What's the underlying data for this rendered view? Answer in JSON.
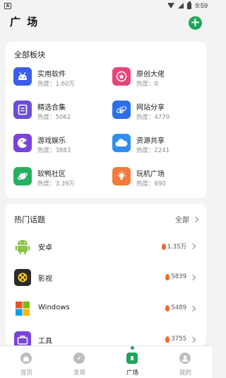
{
  "status": {
    "time": "9:59",
    "left_badge": "A"
  },
  "header": {
    "title": "广 场",
    "add_label": "+"
  },
  "boards": {
    "heading": "全部板块",
    "items": [
      {
        "name": "实用软件",
        "heat": "热度：1.60万",
        "icon": "android-icon",
        "color": "#3c5de8"
      },
      {
        "name": "原创大佬",
        "heat": "热度：0",
        "icon": "star-badge-icon",
        "color": "#e6447a"
      },
      {
        "name": "精选合集",
        "heat": "热度：5062",
        "icon": "collection-icon",
        "color": "#6b4ed6"
      },
      {
        "name": "网站分享",
        "heat": "热度：4770",
        "icon": "browser-icon",
        "color": "#2f6ee8"
      },
      {
        "name": "游戏娱乐",
        "heat": "热度：3883",
        "icon": "pacman-icon",
        "color": "#7a44d8"
      },
      {
        "name": "资源共享",
        "heat": "热度：2241",
        "icon": "cloud-icon",
        "color": "#2f8ff0"
      },
      {
        "name": "软鸭社区",
        "heat": "热度：3.39万",
        "icon": "planet-icon",
        "color": "#27b061"
      },
      {
        "name": "玩机广场",
        "heat": "热度：690",
        "icon": "bulb-icon",
        "color": "#f27a3a"
      }
    ]
  },
  "topics": {
    "heading": "热门话题",
    "more_label": "全部",
    "items": [
      {
        "name": "安卓",
        "heat": "1.35万",
        "icon": "android-logo-icon"
      },
      {
        "name": "影视",
        "heat": "5839",
        "icon": "film-reel-icon"
      },
      {
        "name": "Windows",
        "heat": "5489",
        "icon": "windows-logo-icon"
      },
      {
        "name": "工具",
        "heat": "3755",
        "icon": "toolbox-icon"
      }
    ]
  },
  "tabbar": {
    "items": [
      {
        "label": "首页",
        "icon": "home-icon"
      },
      {
        "label": "发现",
        "icon": "compass-icon"
      },
      {
        "label": "广场",
        "icon": "square-icon",
        "active": true
      },
      {
        "label": "我的",
        "icon": "profile-icon"
      }
    ]
  }
}
